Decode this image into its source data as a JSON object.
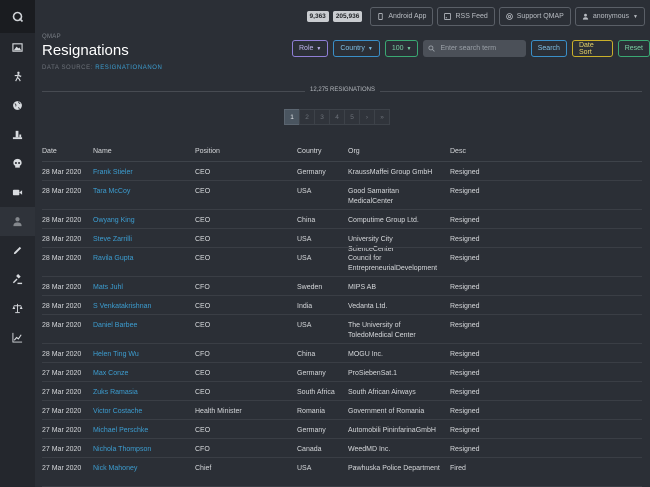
{
  "app": {
    "logo_letter": "Q"
  },
  "sidebar": {
    "items": [
      {
        "icon": "image-icon",
        "active": false
      },
      {
        "icon": "running-person-icon",
        "active": false
      },
      {
        "icon": "globe-icon",
        "active": false
      },
      {
        "icon": "podium-icon",
        "active": false
      },
      {
        "icon": "skull-icon",
        "active": false
      },
      {
        "icon": "video-camera-icon",
        "active": false
      },
      {
        "icon": "person-icon",
        "active": true
      },
      {
        "icon": "pencil-icon",
        "active": false
      },
      {
        "icon": "gavel-icon",
        "active": false
      },
      {
        "icon": "scales-icon",
        "active": false
      },
      {
        "icon": "bar-chart-icon",
        "active": false
      }
    ]
  },
  "topbar": {
    "count1": "9,363",
    "count2": "205,936",
    "android_label": "Android App",
    "rss_label": "RSS Feed",
    "support_label": "Support QMAP",
    "user_label": "anonymous"
  },
  "page": {
    "breadcrumb": "QMAP",
    "title": "Resignations",
    "source_label": "DATA SOURCE:",
    "source_value": "RESIGNATIONANON"
  },
  "filters": {
    "role_label": "Role",
    "country_label": "Country",
    "per_page_label": "100",
    "search_placeholder": "Enter search term",
    "search_button": "Search",
    "date_sort_button": "Date Sort",
    "reset_button": "Reset"
  },
  "summary": {
    "total": "12,275 RESIGNATIONS"
  },
  "pagination": [
    "1",
    "2",
    "3",
    "4",
    "5",
    "›",
    "»"
  ],
  "table": {
    "headers": [
      "Date",
      "Name",
      "Position",
      "Country",
      "Org",
      "Desc"
    ],
    "rows": [
      [
        "28 Mar 2020",
        "Frank Stieler",
        "CEO",
        "Germany",
        "KraussMaffei Group GmbH",
        "Resigned"
      ],
      [
        "28 Mar 2020",
        "Tara McCoy",
        "CEO",
        "USA",
        "Good Samaritan MedicalCenter",
        "Resigned"
      ],
      [
        "28 Mar 2020",
        "Owyang King",
        "CEO",
        "China",
        "Computime Group Ltd.",
        "Resigned"
      ],
      [
        "28 Mar 2020",
        "Steve Zarrilli",
        "CEO",
        "USA",
        "University City ScienceCenter",
        "Resigned"
      ],
      [
        "28 Mar 2020",
        "Ravila Gupta",
        "CEO",
        "USA",
        "Council for EntrepreneurialDevelopment",
        "Resigned"
      ],
      [
        "28 Mar 2020",
        "Mats Juhl",
        "CFO",
        "Sweden",
        "MIPS AB",
        "Resigned"
      ],
      [
        "28 Mar 2020",
        "S Venkatakrishnan",
        "CEO",
        "India",
        "Vedanta Ltd.",
        "Resigned"
      ],
      [
        "28 Mar 2020",
        "Daniel Barbee",
        "CEO",
        "USA",
        "The University of ToledoMedical Center",
        "Resigned"
      ],
      [
        "28 Mar 2020",
        "Helen Ting Wu",
        "CFO",
        "China",
        "MOGU Inc.",
        "Resigned"
      ],
      [
        "27 Mar 2020",
        "Max Conze",
        "CEO",
        "Germany",
        "ProSiebenSat.1",
        "Resigned"
      ],
      [
        "27 Mar 2020",
        "Zuks Ramasia",
        "CEO",
        "South Africa",
        "South African Airways",
        "Resigned"
      ],
      [
        "27 Mar 2020",
        "Victor Costache",
        "Health Minister",
        "Romania",
        "Government of Romania",
        "Resigned"
      ],
      [
        "27 Mar 2020",
        "Michael Perschke",
        "CEO",
        "Germany",
        "Automobili PininfarinaGmbH",
        "Resigned"
      ],
      [
        "27 Mar 2020",
        "Nichola Thompson",
        "CFO",
        "Canada",
        "WeedMD Inc.",
        "Resigned"
      ],
      [
        "27 Mar 2020",
        "Nick Mahoney",
        "Chief",
        "USA",
        "Pawhuska Police Department",
        "Fired"
      ]
    ]
  }
}
